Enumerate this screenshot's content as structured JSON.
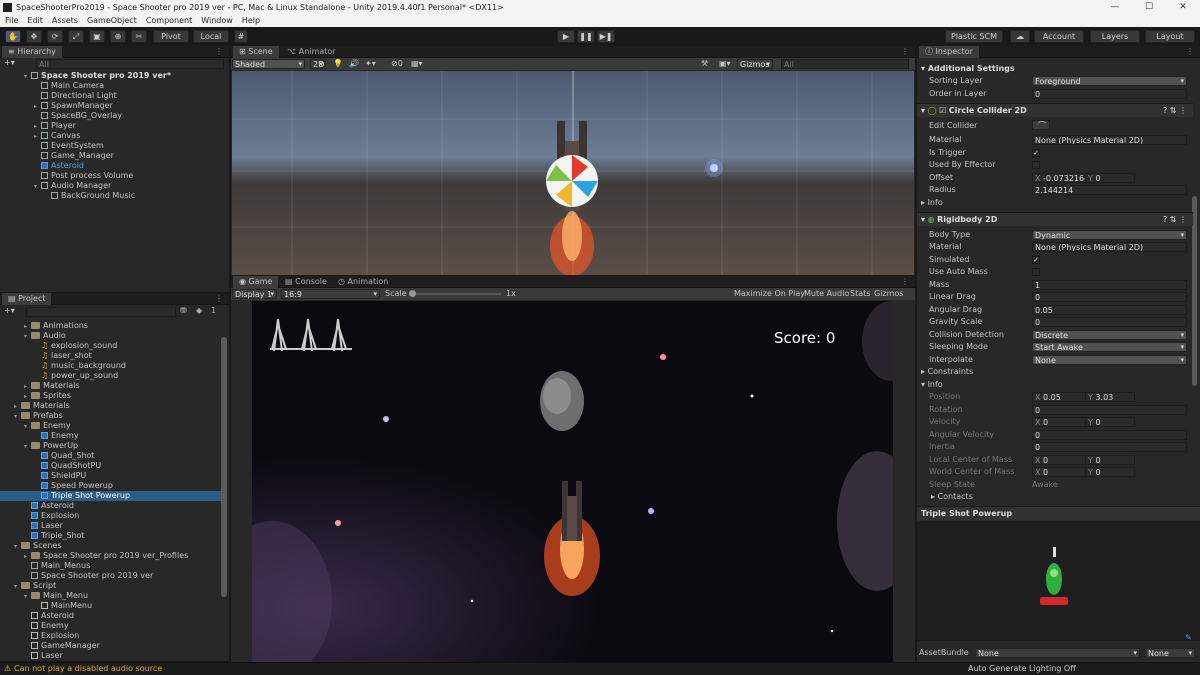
{
  "window": {
    "title": "SpaceShooterPro2019 - Space Shooter pro 2019 ver - PC, Mac & Linux Standalone - Unity 2019.4.40f1 Personal* <DX11>",
    "controls": [
      "—",
      "☐",
      "✕"
    ]
  },
  "menu": [
    "File",
    "Edit",
    "Assets",
    "GameObject",
    "Component",
    "Window",
    "Help"
  ],
  "toolbar": {
    "pivot": "Pivot",
    "local": "Local",
    "play": "▶",
    "pause": "❚❚",
    "step": "▶❚",
    "plastic": "Plastic SCM",
    "account": "Account",
    "layers": "Layers",
    "layout": "Layout"
  },
  "hierarchy": {
    "tab": "Hierarchy",
    "search_placeholder": "All",
    "scene": "Space Shooter pro 2019 ver*",
    "items": [
      {
        "label": "Main Camera",
        "indent": 1
      },
      {
        "label": "Directional Light",
        "indent": 1
      },
      {
        "label": "SpawnManager",
        "indent": 1,
        "arrow": "▸"
      },
      {
        "label": "SpaceBG_Overlay",
        "indent": 1
      },
      {
        "label": "Player",
        "indent": 1,
        "arrow": "▸"
      },
      {
        "label": "Canvas",
        "indent": 1,
        "arrow": "▸"
      },
      {
        "label": "EventSystem",
        "indent": 1
      },
      {
        "label": "Game_Manager",
        "indent": 1
      },
      {
        "label": "Asteroid",
        "indent": 1,
        "blue": true
      },
      {
        "label": "Post process Volume",
        "indent": 1
      },
      {
        "label": "Audio Manager",
        "indent": 1,
        "arrow": "▾"
      },
      {
        "label": "BackGround Music",
        "indent": 2
      }
    ]
  },
  "project": {
    "tab": "Project",
    "hidden_count": "1",
    "items": [
      {
        "label": "Animations",
        "indent": 2,
        "type": "folder",
        "arrow": "▸"
      },
      {
        "label": "Audio",
        "indent": 2,
        "type": "folder",
        "arrow": "▾"
      },
      {
        "label": "explosion_sound",
        "indent": 3,
        "type": "audio"
      },
      {
        "label": "laser_shot",
        "indent": 3,
        "type": "audio"
      },
      {
        "label": "music_background",
        "indent": 3,
        "type": "audio"
      },
      {
        "label": "power_up_sound",
        "indent": 3,
        "type": "audio"
      },
      {
        "label": "Materials",
        "indent": 2,
        "type": "folder",
        "arrow": "▸"
      },
      {
        "label": "Sprites",
        "indent": 2,
        "type": "folder",
        "arrow": "▸"
      },
      {
        "label": "Materials",
        "indent": 1,
        "type": "folder",
        "arrow": "▸"
      },
      {
        "label": "Prefabs",
        "indent": 1,
        "type": "folder",
        "arrow": "▾"
      },
      {
        "label": "Enemy",
        "indent": 2,
        "type": "folder",
        "arrow": "▾"
      },
      {
        "label": "Enemy",
        "indent": 3,
        "type": "prefab"
      },
      {
        "label": "PowerUp",
        "indent": 2,
        "type": "folder",
        "arrow": "▾"
      },
      {
        "label": "Quad_Shot",
        "indent": 3,
        "type": "prefab"
      },
      {
        "label": "QuadShotPU",
        "indent": 3,
        "type": "prefab"
      },
      {
        "label": "ShieldPU",
        "indent": 3,
        "type": "prefab"
      },
      {
        "label": "Speed Powerup",
        "indent": 3,
        "type": "prefab"
      },
      {
        "label": "Triple Shot Powerup",
        "indent": 3,
        "type": "prefab",
        "sel": true
      },
      {
        "label": "Asteroid",
        "indent": 2,
        "type": "prefab"
      },
      {
        "label": "Explosion",
        "indent": 2,
        "type": "prefab"
      },
      {
        "label": "Laser",
        "indent": 2,
        "type": "prefab"
      },
      {
        "label": "Triple_Shot",
        "indent": 2,
        "type": "prefab"
      },
      {
        "label": "Scenes",
        "indent": 1,
        "type": "folder",
        "arrow": "▾"
      },
      {
        "label": "Space Shooter pro 2019 ver_Profiles",
        "indent": 2,
        "type": "folder",
        "arrow": "▸"
      },
      {
        "label": "Main_Menus",
        "indent": 2,
        "type": "scene"
      },
      {
        "label": "Space Shooter pro 2019 ver",
        "indent": 2,
        "type": "scene"
      },
      {
        "label": "Script",
        "indent": 1,
        "type": "folder",
        "arrow": "▾"
      },
      {
        "label": "Main_Menu",
        "indent": 2,
        "type": "folder",
        "arrow": "▾"
      },
      {
        "label": "MainMenu",
        "indent": 3,
        "type": "script"
      },
      {
        "label": "Asteroid",
        "indent": 2,
        "type": "script"
      },
      {
        "label": "Enemy",
        "indent": 2,
        "type": "script"
      },
      {
        "label": "Explosion",
        "indent": 2,
        "type": "script"
      },
      {
        "label": "GameManager",
        "indent": 2,
        "type": "script"
      },
      {
        "label": "Laser",
        "indent": 2,
        "type": "script"
      }
    ]
  },
  "scene": {
    "tab_scene": "Scene",
    "tab_animator": "Animator",
    "shading": "Shaded",
    "mode2d": "2D",
    "hidden": "0",
    "gizmos": "Gizmos",
    "search_placeholder": "All"
  },
  "game": {
    "tab_game": "Game",
    "tab_console": "Console",
    "tab_animation": "Animation",
    "display": "Display 1",
    "aspect": "16:9",
    "scale_label": "Scale",
    "scale_value": "1x",
    "maximize": "Maximize On Play",
    "mute": "Mute Audio",
    "stats": "Stats",
    "gizmos": "Gizmos",
    "score": "Score: 0"
  },
  "inspector": {
    "tab": "Inspector",
    "additional": {
      "title": "Additional Settings",
      "sorting_layer_label": "Sorting Layer",
      "sorting_layer": "Foreground",
      "order_label": "Order in Layer",
      "order": "0"
    },
    "circle": {
      "title": "Circle Collider 2D",
      "edit": "Edit Collider",
      "material_label": "Material",
      "material": "None (Physics Material 2D)",
      "trigger": "Is Trigger",
      "effector": "Used By Effector",
      "offset_label": "Offset",
      "offset_x": "-0.0732164",
      "offset_y": "0",
      "radius_label": "Radius",
      "radius": "2.144214",
      "info": "Info"
    },
    "rigidbody": {
      "title": "Rigidbody 2D",
      "body_type_label": "Body Type",
      "body_type": "Dynamic",
      "material_label": "Material",
      "material": "None (Physics Material 2D)",
      "simulated": "Simulated",
      "auto_mass": "Use Auto Mass",
      "mass_label": "Mass",
      "mass": "1",
      "linear_label": "Linear Drag",
      "linear": "0",
      "angular_label": "Angular Drag",
      "angular": "0.05",
      "gravity_label": "Gravity Scale",
      "gravity": "0",
      "collision_label": "Collision Detection",
      "collision": "Discrete",
      "sleep_label": "Sleeping Mode",
      "sleep": "Start Awake",
      "interp_label": "Interpolate",
      "interp": "None",
      "constraints": "Constraints",
      "info": "Info",
      "pos_label": "Position",
      "pos_x": "0.05",
      "pos_y": "3.03",
      "rot_label": "Rotation",
      "rot": "0",
      "vel_label": "Velocity",
      "vel_x": "0",
      "vel_y": "0",
      "angvel_label": "Angular Velocity",
      "angvel": "0",
      "inertia_label": "Inertia",
      "inertia": "0",
      "lcom_label": "Local Center of Mass",
      "lcom_x": "0",
      "lcom_y": "0",
      "wcom_label": "World Center of Mass",
      "wcom_x": "0",
      "wcom_y": "0",
      "sleep_state_label": "Sleep State",
      "sleep_state": "Awake",
      "contacts": "Contacts"
    },
    "preview_title": "Triple Shot Powerup",
    "assetbundle_label": "AssetBundle",
    "assetbundle": "None",
    "variant": "None"
  },
  "status": {
    "warning": "Can not play a disabled audio source",
    "lighting": "Auto Generate Lighting Off"
  }
}
